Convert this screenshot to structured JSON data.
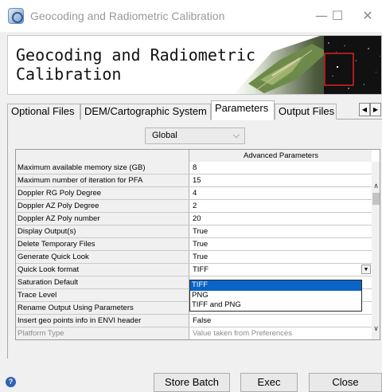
{
  "window": {
    "title": "Geocoding and Radiometric Calibration",
    "minimize_glyph": "—",
    "maximize_glyph": "☐",
    "close_glyph": "✕"
  },
  "banner": {
    "title": "Geocoding and Radiometric\nCalibration"
  },
  "tabs": [
    {
      "label": "Optional Files",
      "active": false
    },
    {
      "label": "DEM/Cartographic System",
      "active": false
    },
    {
      "label": "Parameters",
      "active": true
    },
    {
      "label": "Output Files",
      "active": false
    }
  ],
  "tab_scroll": {
    "left": "◀",
    "right": "▶"
  },
  "scope_select": {
    "value": "Global",
    "arrow": "⌵"
  },
  "table": {
    "column_header": "Advanced Parameters",
    "rows": [
      {
        "name": "Maximum available memory size (GB)",
        "value": "8"
      },
      {
        "name": "Maximum number of iteration for PFA",
        "value": "15"
      },
      {
        "name": "Doppler RG Poly Degree",
        "value": "4"
      },
      {
        "name": "Doppler AZ Poly Degree",
        "value": "2"
      },
      {
        "name": "Doppler AZ Poly number",
        "value": "20"
      },
      {
        "name": "Display Output(s)",
        "value": "True"
      },
      {
        "name": "Delete Temporary Files",
        "value": "True"
      },
      {
        "name": "Generate Quick Look",
        "value": "True"
      },
      {
        "name": "Quick Look format",
        "value": "TIFF"
      },
      {
        "name": "Saturation Default",
        "value": ""
      },
      {
        "name": "Trace Level",
        "value": ""
      },
      {
        "name": "Rename Output Using Parameters",
        "value": "True"
      },
      {
        "name": "Insert geo points info in ENVI header",
        "value": "False"
      },
      {
        "name": "Platform Type",
        "value": "Value taken from Preferences"
      }
    ]
  },
  "quicklook_dropdown": {
    "options": [
      "TIFF",
      "PNG",
      "TIFF and PNG"
    ],
    "selected": "TIFF"
  },
  "scrollbar": {
    "up": "∧",
    "down": "∨"
  },
  "buttons": {
    "help": "?",
    "store_batch": "Store Batch",
    "exec": "Exec",
    "close": "Close"
  },
  "colors": {
    "selection": "#0a64c8",
    "help_icon": "#2f62b5"
  }
}
